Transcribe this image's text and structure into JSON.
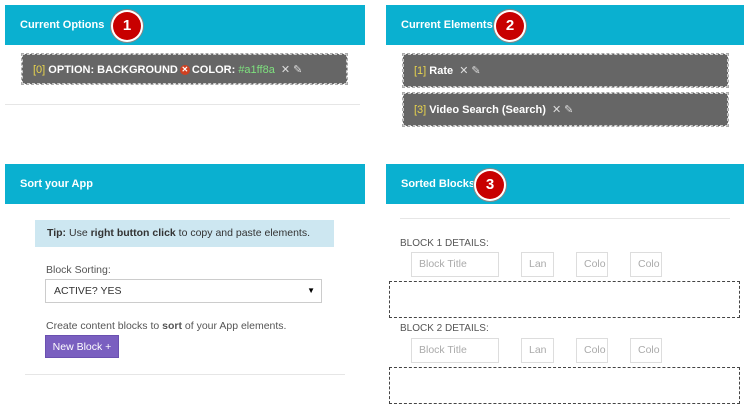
{
  "panels": {
    "current_options": {
      "title": "Current Options",
      "badge": "1",
      "items": [
        {
          "index": "[0]",
          "text": "OPTION: BACKGROUND",
          "text2": "COLOR:",
          "hex": "#a1ff8a"
        }
      ]
    },
    "current_elements": {
      "title": "Current Elements",
      "badge": "2",
      "items": [
        {
          "index": "[1]",
          "text": "Rate"
        },
        {
          "index": "[3]",
          "text": "Video Search (Search)"
        }
      ]
    },
    "sort_app": {
      "title": "Sort your App",
      "tip_prefix": "Tip:",
      "tip_mid1": " Use ",
      "tip_bold": "right button click",
      "tip_suffix": " to copy and paste elements.",
      "sorting_label": "Block Sorting:",
      "sorting_value": "ACTIVE? YES",
      "create_text_pre": "Create content blocks to ",
      "create_text_bold": "sort",
      "create_text_post": " of your App elements.",
      "new_block_button": "New Block +"
    },
    "sorted_blocks": {
      "title": "Sorted Blocks",
      "badge": "3",
      "blocks": [
        {
          "label": "BLOCK 1 DETAILS:",
          "title_placeholder": "Block Title",
          "lang_placeholder": "Lan",
          "color1_placeholder": "Colo",
          "color2_placeholder": "Colo"
        },
        {
          "label": "BLOCK 2 DETAILS:",
          "title_placeholder": "Block Title",
          "lang_placeholder": "Lan",
          "color1_placeholder": "Colo",
          "color2_placeholder": "Colo"
        }
      ]
    }
  },
  "icons": {
    "delete": "close-icon",
    "edit": "edit-icon",
    "remove_option": "remove-circle-icon"
  },
  "colors": {
    "header": "#0ab0d0",
    "badge": "#c80000",
    "item_bg": "#666666",
    "button": "#7a5fc0",
    "tip_bg": "#cde7f1"
  }
}
